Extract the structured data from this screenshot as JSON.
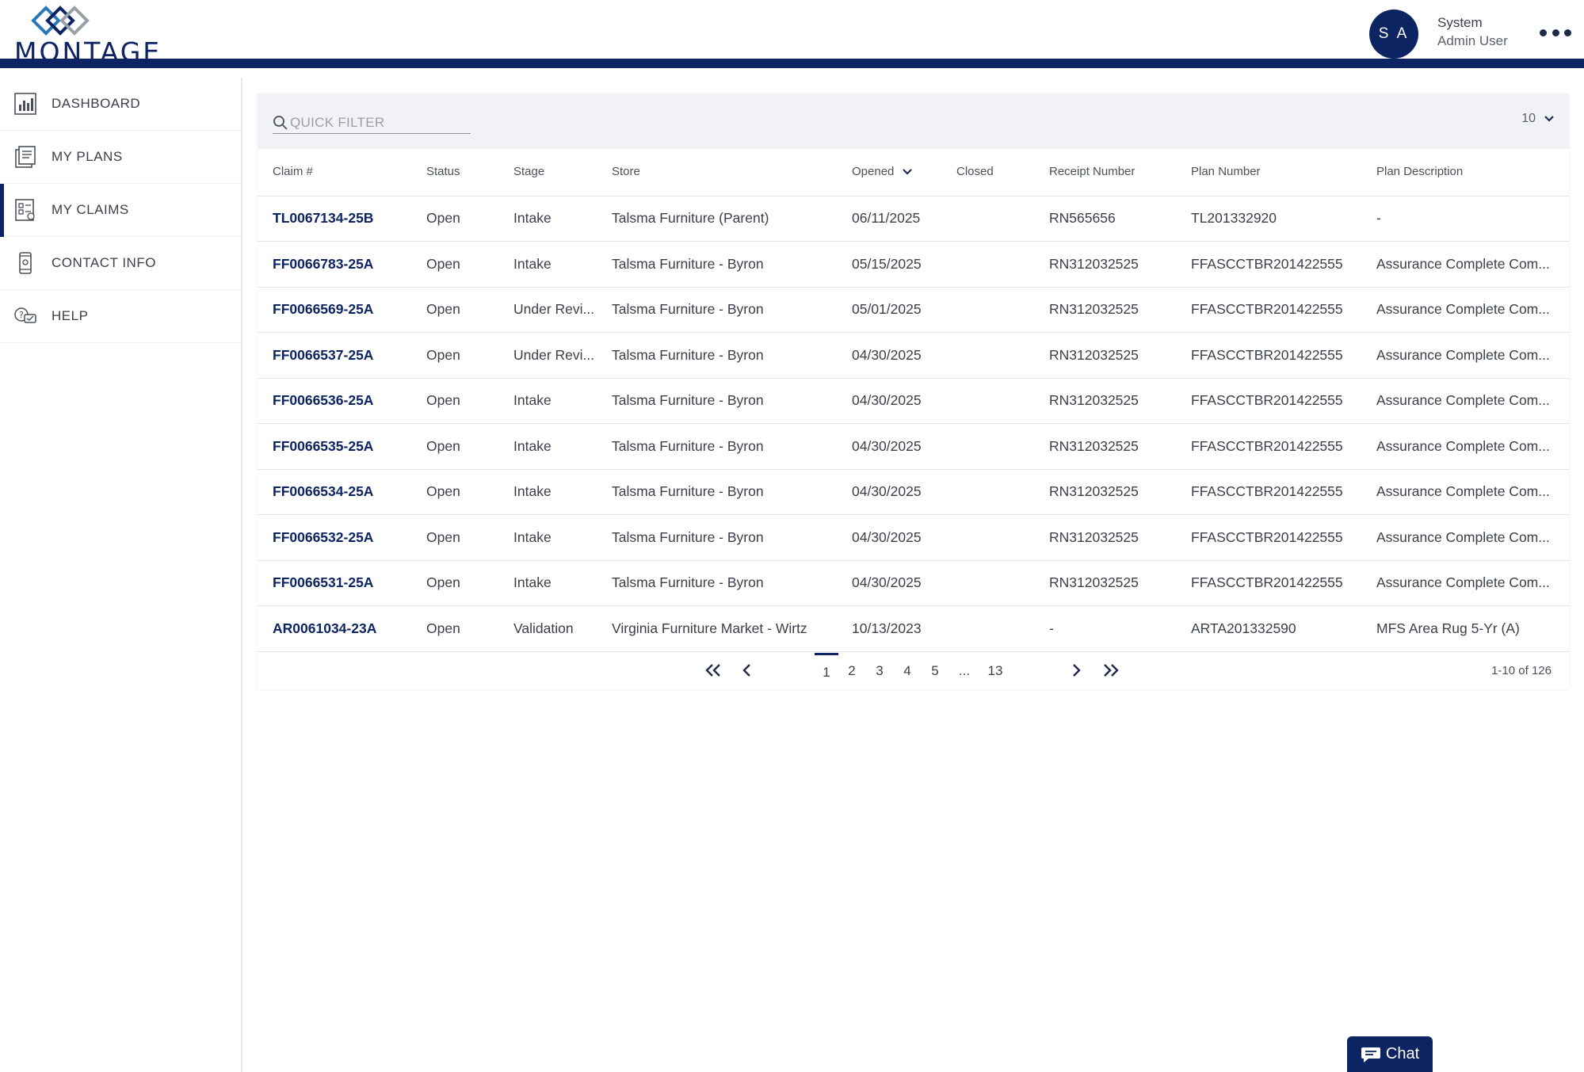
{
  "brand": {
    "name": "MONTAGE",
    "color": "#0d2463",
    "accent": "#2a7ab8"
  },
  "user": {
    "initials": "S A",
    "first_name": "System",
    "role": "Admin User"
  },
  "sidebar": {
    "items": [
      {
        "label": "DASHBOARD",
        "icon": "dashboard-icon",
        "active": false
      },
      {
        "label": "MY PLANS",
        "icon": "plans-icon",
        "active": false
      },
      {
        "label": "MY CLAIMS",
        "icon": "claims-icon",
        "active": true
      },
      {
        "label": "CONTACT INFO",
        "icon": "phone-icon",
        "active": false
      },
      {
        "label": "HELP",
        "icon": "help-icon",
        "active": false
      }
    ]
  },
  "toolbar": {
    "search_placeholder": "QUICK FILTER",
    "search_value": "",
    "page_size": "10"
  },
  "table": {
    "columns": [
      "Claim #",
      "Status",
      "Stage",
      "Store",
      "Opened",
      "Closed",
      "Receipt Number",
      "Plan Number",
      "Plan Description"
    ],
    "sort_column": "Opened",
    "sort_direction": "descending",
    "rows": [
      [
        "TL0067134-25B",
        "Open",
        "Intake",
        "Talsma Furniture (Parent)",
        "06/11/2025",
        "",
        "RN565656",
        "TL201332920",
        "-"
      ],
      [
        "FF0066783-25A",
        "Open",
        "Intake",
        "Talsma Furniture - Byron",
        "05/15/2025",
        "",
        "RN312032525",
        "FFASCCTBR201422555",
        "Assurance Complete Com..."
      ],
      [
        "FF0066569-25A",
        "Open",
        "Under Revi...",
        "Talsma Furniture - Byron",
        "05/01/2025",
        "",
        "RN312032525",
        "FFASCCTBR201422555",
        "Assurance Complete Com..."
      ],
      [
        "FF0066537-25A",
        "Open",
        "Under Revi...",
        "Talsma Furniture - Byron",
        "04/30/2025",
        "",
        "RN312032525",
        "FFASCCTBR201422555",
        "Assurance Complete Com..."
      ],
      [
        "FF0066536-25A",
        "Open",
        "Intake",
        "Talsma Furniture - Byron",
        "04/30/2025",
        "",
        "RN312032525",
        "FFASCCTBR201422555",
        "Assurance Complete Com..."
      ],
      [
        "FF0066535-25A",
        "Open",
        "Intake",
        "Talsma Furniture - Byron",
        "04/30/2025",
        "",
        "RN312032525",
        "FFASCCTBR201422555",
        "Assurance Complete Com..."
      ],
      [
        "FF0066534-25A",
        "Open",
        "Intake",
        "Talsma Furniture - Byron",
        "04/30/2025",
        "",
        "RN312032525",
        "FFASCCTBR201422555",
        "Assurance Complete Com..."
      ],
      [
        "FF0066532-25A",
        "Open",
        "Intake",
        "Talsma Furniture - Byron",
        "04/30/2025",
        "",
        "RN312032525",
        "FFASCCTBR201422555",
        "Assurance Complete Com..."
      ],
      [
        "FF0066531-25A",
        "Open",
        "Intake",
        "Talsma Furniture - Byron",
        "04/30/2025",
        "",
        "RN312032525",
        "FFASCCTBR201422555",
        "Assurance Complete Com..."
      ],
      [
        "AR0061034-23A",
        "Open",
        "Validation",
        "Virginia Furniture Market - Wirtz",
        "10/13/2023",
        "",
        "-",
        "ARTA201332590",
        "MFS Area Rug 5-Yr (A)"
      ]
    ]
  },
  "pagination": {
    "pages": [
      "1",
      "2",
      "3",
      "4",
      "5",
      "...",
      "13"
    ],
    "current": "1",
    "range_text": "1-10 of 126"
  },
  "chat": {
    "label": "Chat"
  }
}
